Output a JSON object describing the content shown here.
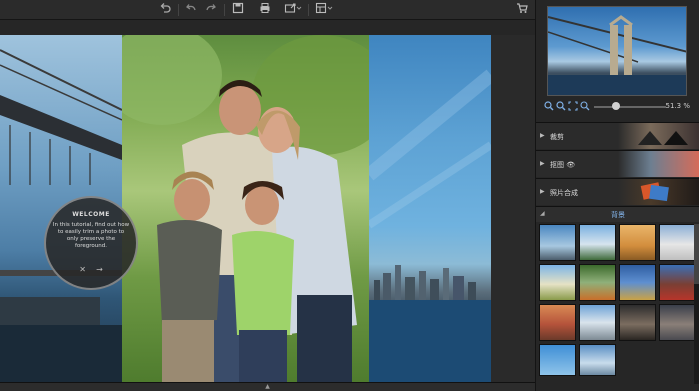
{
  "toolbar": {
    "undo_icon": "undo-icon",
    "back_icon": "back-arrow-icon",
    "forward_icon": "forward-arrow-icon",
    "save_icon": "save-icon",
    "print_icon": "print-icon",
    "export_icon": "export-icon",
    "layout_icon": "layout-icon",
    "cart_icon": "cart-icon"
  },
  "welcome": {
    "title": "WELCOME",
    "text": "In this tutorial, find out how to easily trim a photo to only preserve the foreground.",
    "close_glyph": "✕",
    "next_glyph": "→"
  },
  "zoom": {
    "value": "51.3 %"
  },
  "sections": [
    {
      "label": "裁剪"
    },
    {
      "label": "抠图 👁"
    },
    {
      "label": "照片合成"
    }
  ],
  "library": {
    "title": "背景"
  },
  "colors": {
    "accent": "#7fb0e6",
    "panel_bg": "#262626",
    "toolbar_bg": "#2b2b2b"
  }
}
